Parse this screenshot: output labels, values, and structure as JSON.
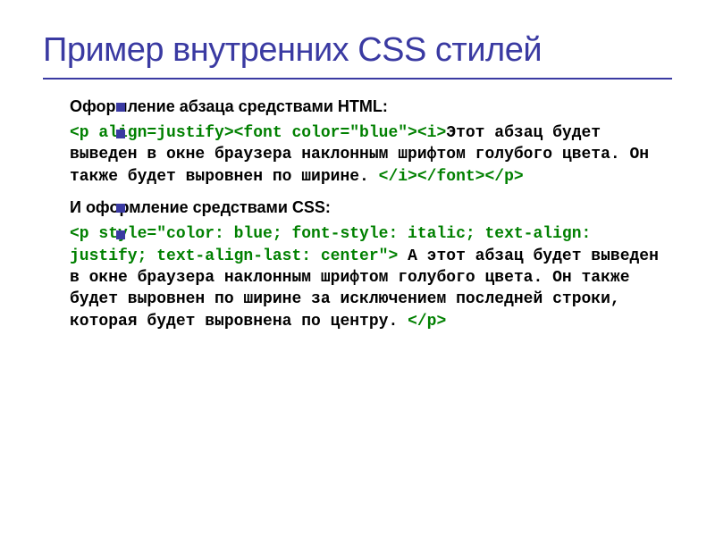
{
  "title": "Пример внутренних CSS стилей",
  "section1": {
    "heading": "Оформление абзаца средствами HTML:",
    "code_open": "<p align=justify><font color=\"blue\"><i>",
    "text": "Этот абзац будет выведен в окне браузера наклонным шрифтом голубого цвета. Он также будет выровнен по ширине. ",
    "code_close": "</i></font></p>"
  },
  "section2": {
    "heading": "И оформление средствами CSS:",
    "code_open": "<p style=\"color: blue; font-style: italic; text-align: justify; text-align-last: center\">",
    "text": " А этот абзац будет выведен в окне браузера наклонным шрифтом голубого цвета. Он также будет выровнен по ширине за исключением последней строки, которая будет выровнена по центру. ",
    "code_close": "</p>"
  }
}
